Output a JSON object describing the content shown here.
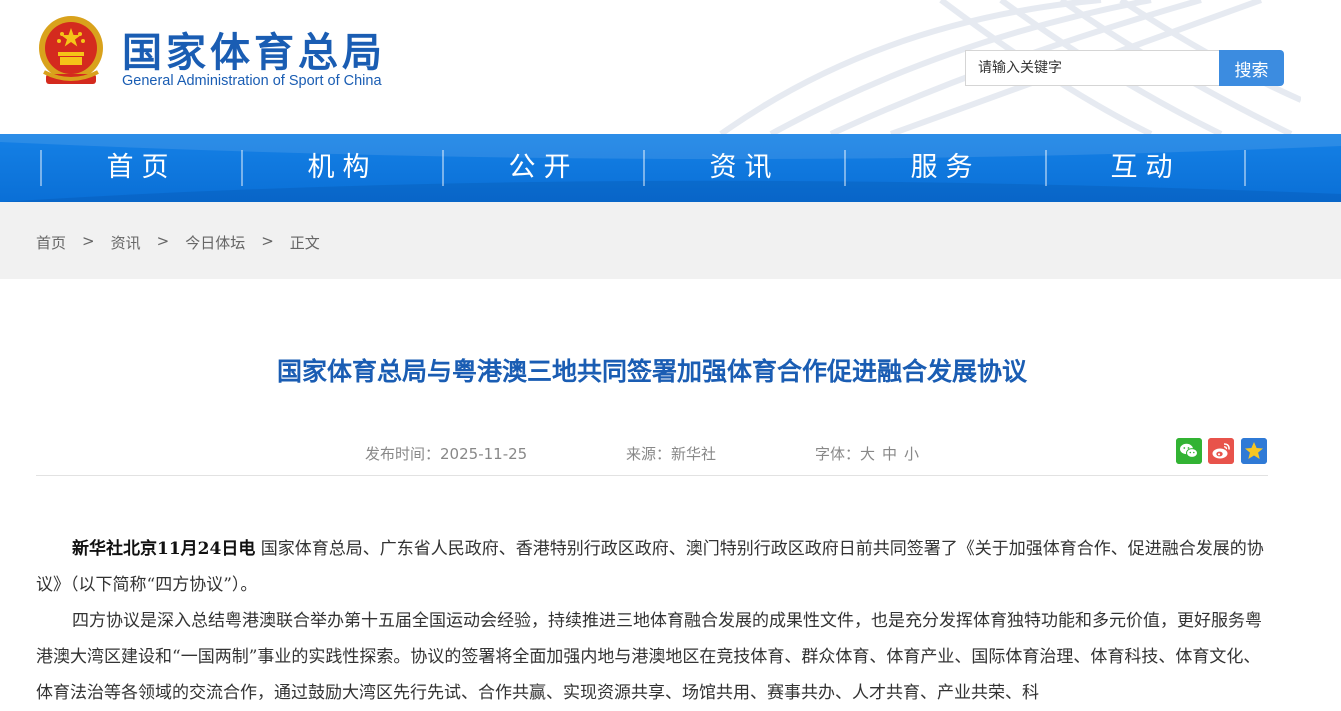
{
  "header": {
    "site_name_cn": "国家体育总局",
    "site_name_en": "General Administration of Sport of China",
    "search_placeholder": "请输入关键字",
    "search_button": "搜索"
  },
  "nav": {
    "items": [
      "首页",
      "机构",
      "公开",
      "资讯",
      "服务",
      "互动"
    ]
  },
  "breadcrumb": {
    "items": [
      "首页",
      "资讯",
      "今日体坛",
      "正文"
    ],
    "separator": ">"
  },
  "article": {
    "title": "国家体育总局与粤港澳三地共同签署加强体育合作促进融合发展协议",
    "publish_label": "发布时间：",
    "publish_date": "2025-11-25",
    "source_label": "来源：",
    "source": "新华社",
    "font_label": "字体：",
    "font_sizes": [
      "大",
      "中",
      "小"
    ],
    "share_icons": [
      "wechat-icon",
      "weibo-icon",
      "favorite-icon"
    ],
    "para1_lead": "新华社北京11月24日电",
    "para1_body": "  国家体育总局、广东省人民政府、香港特别行政区政府、澳门特别行政区政府日前共同签署了《关于加强体育合作、促进融合发展的协议》（以下简称“四方协议”）。",
    "para2": "四方协议是深入总结粤港澳联合举办第十五届全国运动会经验，持续推进三地体育融合发展的成果性文件，也是充分发挥体育独特功能和多元价值，更好服务粤港澳大湾区建设和“一国两制”事业的实践性探索。协议的签署将全面加强内地与港澳地区在竞技体育、群众体育、体育产业、国际体育治理、体育科技、体育文化、体育法治等各领域的交流合作，通过鼓励大湾区先行先试、合作共赢、实现资源共享、场馆共用、赛事共办、人才共育、产业共荣、科"
  },
  "colors": {
    "brand_blue": "#1a5db3",
    "nav_blue": "#0a6fd6",
    "search_button": "#3c8ce0",
    "breadcrumb_bg": "#f1f1f1"
  }
}
